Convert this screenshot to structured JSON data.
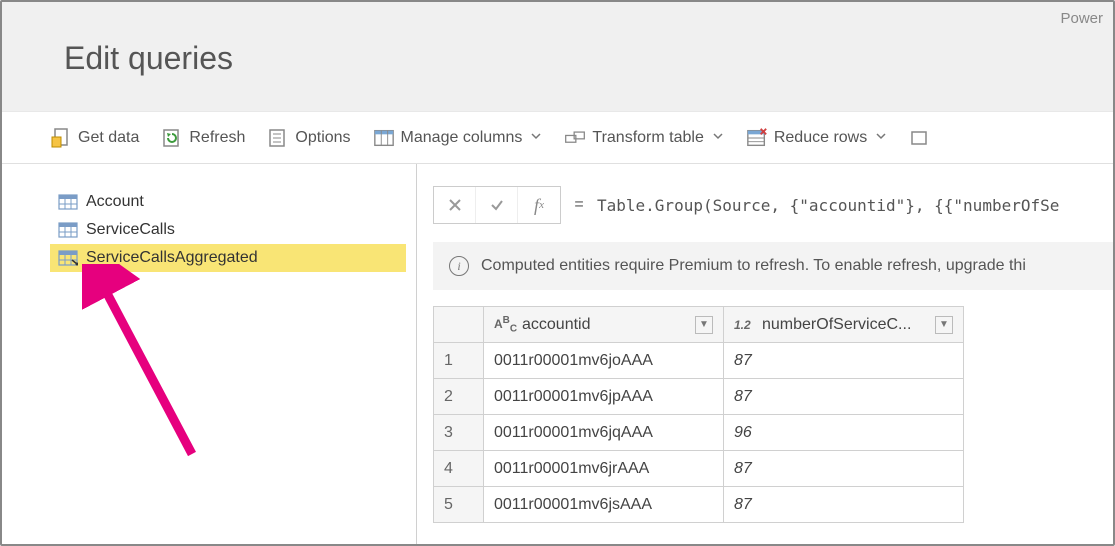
{
  "brand": "Power",
  "title": "Edit queries",
  "toolbar": {
    "get_data": "Get data",
    "refresh": "Refresh",
    "options": "Options",
    "manage_columns": "Manage columns",
    "transform_table": "Transform table",
    "reduce_rows": "Reduce rows"
  },
  "queries": {
    "items": [
      {
        "label": "Account"
      },
      {
        "label": "ServiceCalls"
      },
      {
        "label": "ServiceCallsAggregated"
      }
    ]
  },
  "formula": {
    "eq": "=",
    "text": "Table.Group(Source, {\"accountid\"}, {{\"numberOfSe"
  },
  "info": "Computed entities require Premium to refresh. To enable refresh, upgrade thi",
  "table": {
    "columns": [
      {
        "typeLabel": "ABC",
        "name": "accountid"
      },
      {
        "typeLabel": "1.2",
        "name": "numberOfServiceC..."
      }
    ],
    "rows": [
      {
        "n": "1",
        "accountid": "0011r00001mv6joAAA",
        "value": "87"
      },
      {
        "n": "2",
        "accountid": "0011r00001mv6jpAAA",
        "value": "87"
      },
      {
        "n": "3",
        "accountid": "0011r00001mv6jqAAA",
        "value": "96"
      },
      {
        "n": "4",
        "accountid": "0011r00001mv6jrAAA",
        "value": "87"
      },
      {
        "n": "5",
        "accountid": "0011r00001mv6jsAAA",
        "value": "87"
      }
    ]
  }
}
